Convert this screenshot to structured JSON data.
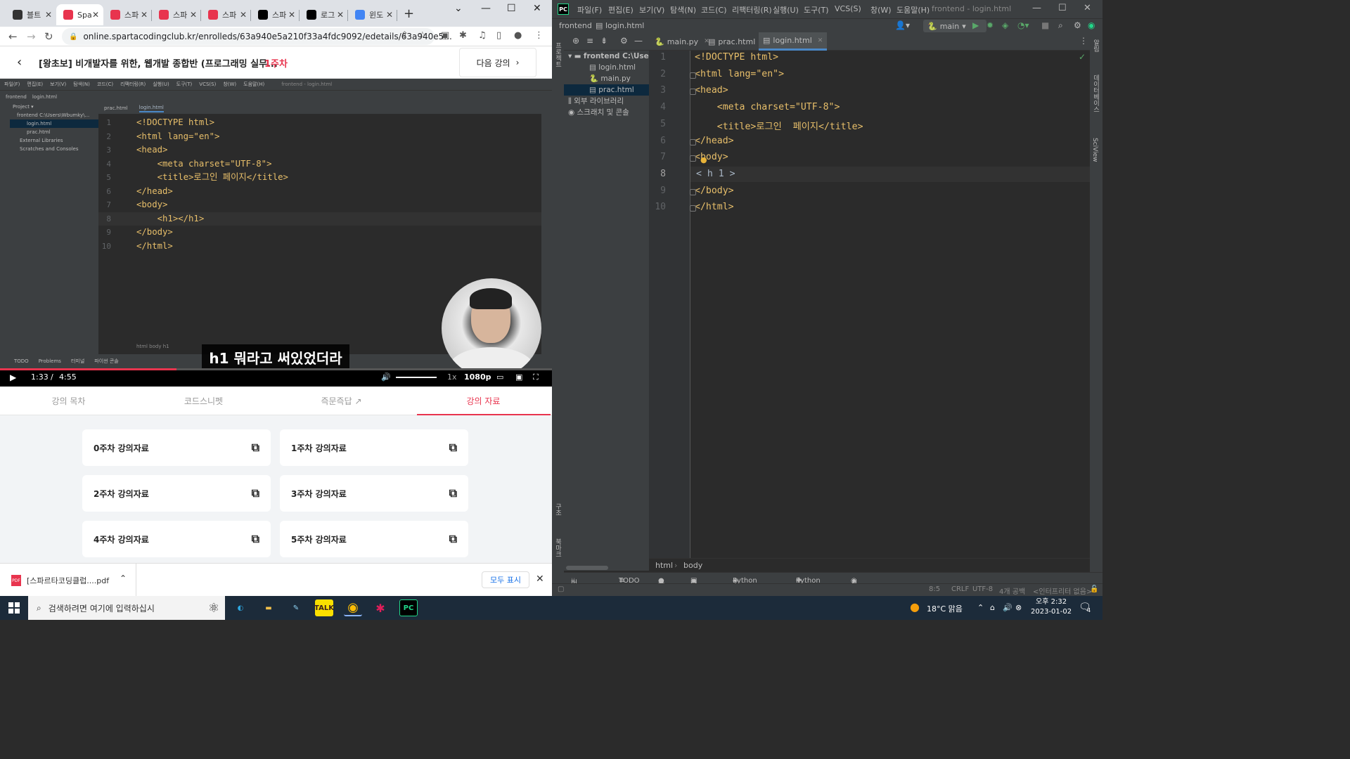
{
  "chrome": {
    "tabs": [
      {
        "title": "블트",
        "color": "#333333"
      },
      {
        "title": "Spa",
        "color": "#e8344e"
      },
      {
        "title": "스파",
        "color": "#e8344e"
      },
      {
        "title": "스파",
        "color": "#e8344e"
      },
      {
        "title": "스파",
        "color": "#e8344e"
      },
      {
        "title": "스파",
        "color": "#000000"
      },
      {
        "title": "로그",
        "color": "#000000"
      },
      {
        "title": "윈도",
        "color": "#4285f4"
      }
    ],
    "url": "online.spartacodingclub.kr/enrolleds/63a940e5a210f33a4fdc9092/edetails/63a940e5...",
    "lecture_title": "[왕초보] 비개발자를 위한, 웹개발 종합반 (프로그래밍 실무...",
    "lecture_week": "1주차",
    "next_label": "다음 강의",
    "video": {
      "menu": [
        "파일(F)",
        "편집(E)",
        "보기(V)",
        "탐색(N)",
        "코드(C)",
        "리팩터링(R)",
        "실행(U)",
        "도구(T)",
        "VCS(S)",
        "창(W)",
        "도움말(H)",
        "frontend - login.html"
      ],
      "path": [
        "frontend",
        "login.html"
      ],
      "project_rows": [
        "Project ▾",
        "frontend  C:\\Users\\Wbumky\\...",
        "login.html",
        "prac.html",
        "External Libraries",
        "Scratches and Consoles"
      ],
      "tabs": [
        "prac.html",
        "login.html"
      ],
      "lines": [
        {
          "n": "1",
          "code": "<!DOCTYPE html>"
        },
        {
          "n": "2",
          "code": "<html lang=\"en\">"
        },
        {
          "n": "3",
          "code": "<head>"
        },
        {
          "n": "4",
          "code": "    <meta charset=\"UTF-8\">"
        },
        {
          "n": "5",
          "code": "    <title>로그인 페이지</title>"
        },
        {
          "n": "6",
          "code": "</head>"
        },
        {
          "n": "7",
          "code": "<body>"
        },
        {
          "n": "8",
          "code": "    <h1></h1>"
        },
        {
          "n": "9",
          "code": "</body>"
        },
        {
          "n": "10",
          "code": "</html>"
        }
      ],
      "breadcrumb": "html    body    h1",
      "bottom_tools": [
        "TODO",
        "Problems",
        "터미널",
        "파이썬 콘솔"
      ],
      "subtitle": "h1 뭐라고 써있었더라",
      "time_current": "1:33",
      "time_sep": "/",
      "time_total": "4:55",
      "speed": "1x",
      "quality": "1080p",
      "progress": 0.32
    },
    "course_tabs": [
      "강의 목차",
      "코드스니펫",
      "즉문즉답",
      "강의 자료"
    ],
    "materials": [
      "0주차 강의자료",
      "1주차 강의자료",
      "2주차 강의자료",
      "3주차 강의자료",
      "4주차 강의자료",
      "5주차 강의자료"
    ],
    "download": {
      "file": "[스파르타코딩클럽....pdf",
      "show_all": "모두 표시"
    }
  },
  "ide": {
    "menu": [
      "파일(F)",
      "편집(E)",
      "보기(V)",
      "탐색(N)",
      "코드(C)",
      "리팩터링(R)",
      "실행(U)",
      "도구(T)",
      "VCS(S)",
      "창(W)",
      "도움말(H)"
    ],
    "title": "frontend - login.html",
    "nav_project": "frontend",
    "nav_file": "login.html",
    "run_config": "main",
    "tree": [
      {
        "label": "frontend  C:\\Users",
        "indent": 0
      },
      {
        "label": "login.html",
        "indent": 1
      },
      {
        "label": "main.py",
        "indent": 1
      },
      {
        "label": "prac.html",
        "indent": 1
      },
      {
        "label": "외부 라이브러리",
        "indent": 0
      },
      {
        "label": "스크래치 및 콘솔",
        "indent": 0
      }
    ],
    "tabs": [
      "main.py",
      "prac.html",
      "login.html"
    ],
    "code": [
      {
        "n": "1",
        "text": "<!DOCTYPE html>"
      },
      {
        "n": "2",
        "text": "<html lang=\"en\">"
      },
      {
        "n": "3",
        "text": "<head>"
      },
      {
        "n": "4",
        "text": "    <meta charset=\"UTF-8\">"
      },
      {
        "n": "5",
        "text": "    <title>로그인  페이지</title>"
      },
      {
        "n": "6",
        "text": "</head>"
      },
      {
        "n": "7",
        "text": "<body>"
      },
      {
        "n": "8",
        "text": "< h 1 >"
      },
      {
        "n": "9",
        "text": "</body>"
      },
      {
        "n": "10",
        "text": "</html>"
      }
    ],
    "breadcrumb": [
      "html",
      "body"
    ],
    "tools": [
      "버전 관리",
      "TODO",
      "문제",
      "터미널",
      "Python 패키지",
      "Python 콘솔",
      "서비스"
    ],
    "status": {
      "pos": "8:5",
      "eol": "CRLF",
      "enc": "UTF-8",
      "indent": "4개 공백",
      "interp": "<인터프리터 없음>"
    },
    "left_labels": [
      "프로젝트",
      "구조",
      "북마크"
    ],
    "right_labels": [
      "알림",
      "데이터베이스",
      "SciView"
    ]
  },
  "taskbar": {
    "search_placeholder": "검색하려면 여기에 입력하십시",
    "weather": "18°C  맑음",
    "time": "오후 2:32",
    "date": "2023-01-02",
    "notif": "4"
  }
}
